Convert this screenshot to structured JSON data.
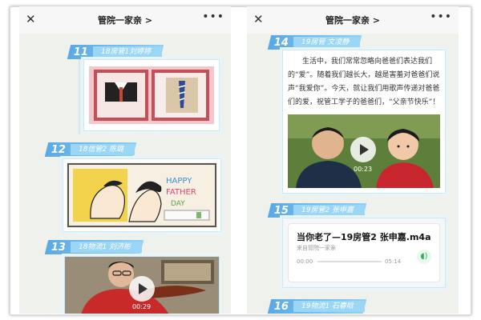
{
  "left_screen": {
    "title": "管院一家亲 >",
    "items": [
      {
        "num": "11",
        "label": "18房管1刘婷婷"
      },
      {
        "num": "12",
        "label": "18信管2 陈璐"
      },
      {
        "num": "13",
        "label": "18物流1 刘济彬"
      }
    ],
    "video_duration": "00:29"
  },
  "right_screen": {
    "title": "管院一家亲 >",
    "items": [
      {
        "num": "14",
        "label": "19房管 文凌静"
      },
      {
        "num": "15",
        "label": "19房管2 张申嘉"
      },
      {
        "num": "16",
        "label": "19物流1 石春晗"
      }
    ],
    "article_text": "生活中，我们常常忽略向爸爸们表达我们的“爱”。随着我们越长大，越是害羞对爸爸们说声“我爱你”。今天，就让我们用歌声传递对爸爸们的爱，祝管工学子的爸爸们，“父亲节快乐”！",
    "video_duration": "00:23",
    "audio": {
      "title": "当你老了—19房管2 张申嘉.m4a",
      "source": "来自管院一家亲",
      "start_time": "00:00",
      "end_time": "05:14"
    }
  },
  "icons": {
    "close": "close-icon",
    "more": "more-icon",
    "play": "play-icon",
    "audio": "audio-wave-icon"
  },
  "colors": {
    "accent": "#5aa9e6",
    "label_bg": "#9ad6f5"
  }
}
